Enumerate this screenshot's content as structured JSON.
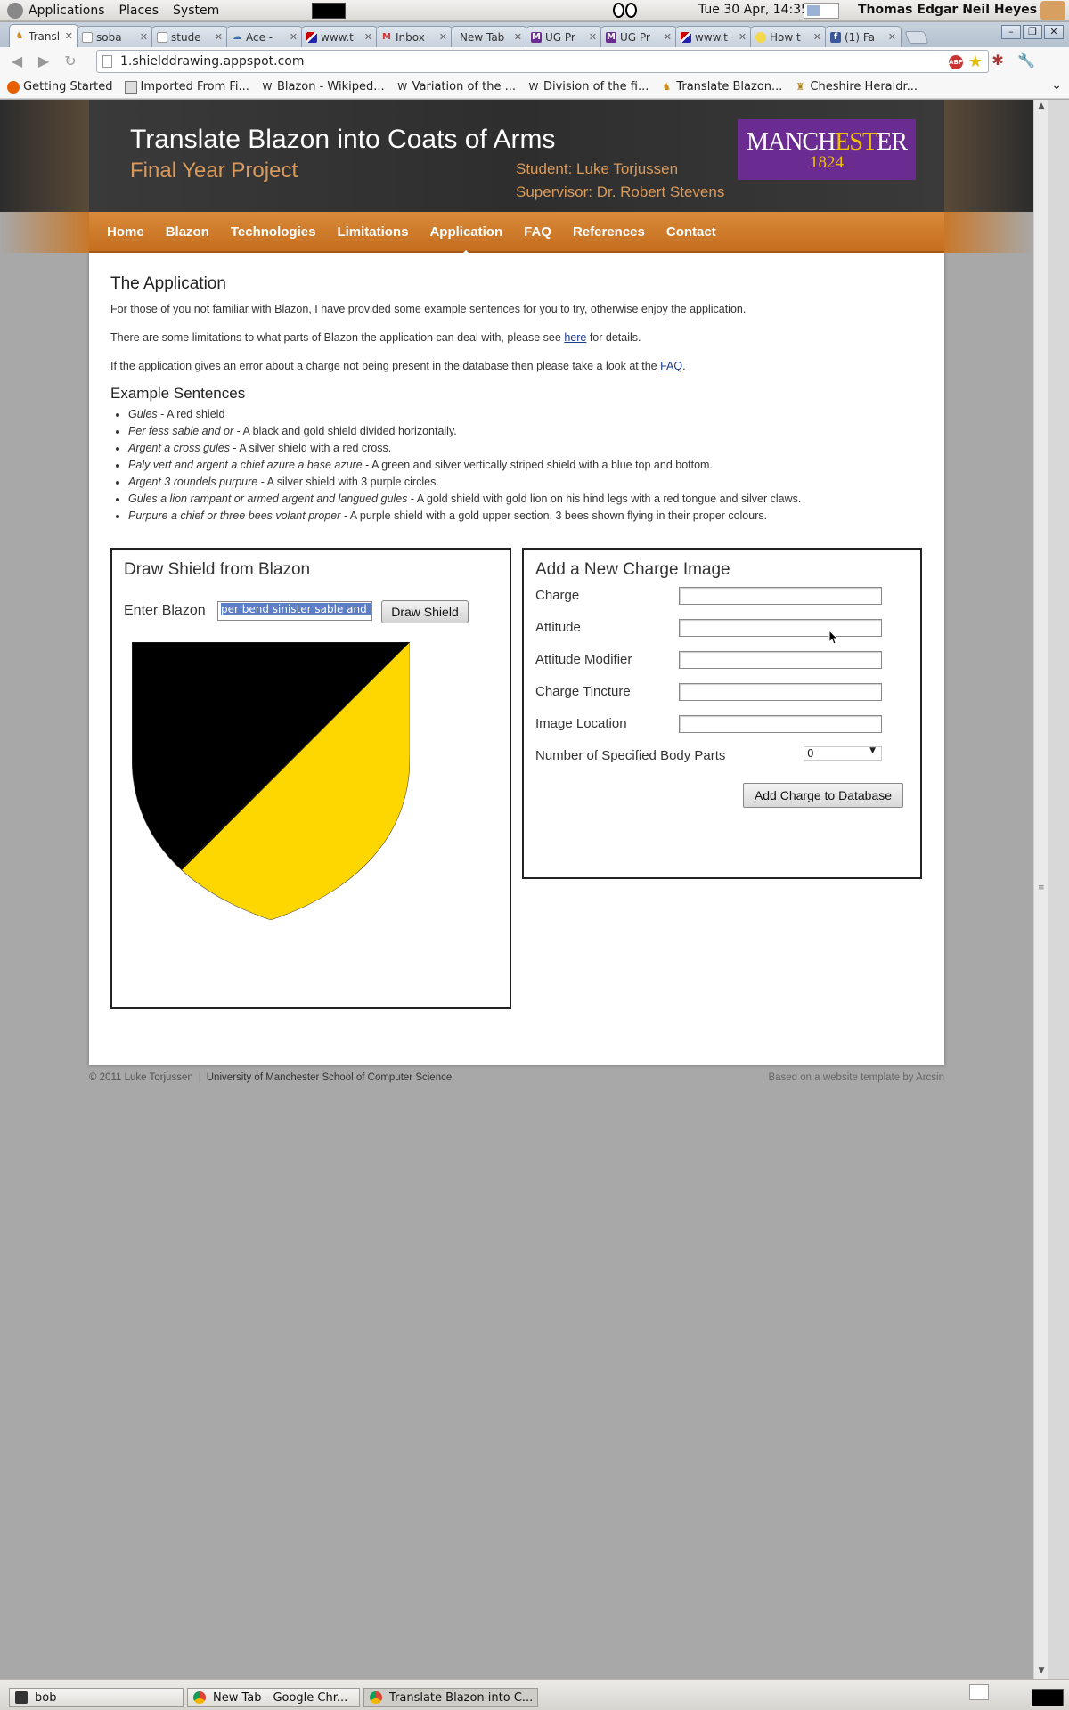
{
  "system_bar": {
    "menus": [
      "Applications",
      "Places",
      "System"
    ],
    "clock": "Tue 30 Apr, 14:35",
    "user": "Thomas Edgar Neil Heyes"
  },
  "tabs": [
    {
      "label": "Transl",
      "active": true
    },
    {
      "label": "soba"
    },
    {
      "label": "stude"
    },
    {
      "label": "Ace -"
    },
    {
      "label": "www.t"
    },
    {
      "label": "Inbox"
    },
    {
      "label": "New Tab"
    },
    {
      "label": "UG Pr"
    },
    {
      "label": "UG Pr"
    },
    {
      "label": "www.t"
    },
    {
      "label": "How t"
    },
    {
      "label": "(1) Fa"
    }
  ],
  "address_bar": {
    "url": "1.shielddrawing.appspot.com"
  },
  "bookmarks": [
    {
      "label": "Getting Started"
    },
    {
      "label": "Imported From Fi..."
    },
    {
      "label": "Blazon - Wikiped..."
    },
    {
      "label": "Variation of the ..."
    },
    {
      "label": "Division of the fi..."
    },
    {
      "label": "Translate Blazon..."
    },
    {
      "label": "Cheshire Heraldr..."
    }
  ],
  "header": {
    "title": "Translate Blazon into Coats of Arms",
    "subtitle": "Final Year Project",
    "student": "Student: Luke Torjussen",
    "supervisor": "Supervisor: Dr. Robert Stevens",
    "logo_main": "MANCHESTER",
    "logo_year": "1824"
  },
  "menu": [
    "Home",
    "Blazon",
    "Technologies",
    "Limitations",
    "Application",
    "FAQ",
    "References",
    "Contact"
  ],
  "menu_active": "Application",
  "content": {
    "heading": "The Application",
    "para1": "For those of you not familiar with Blazon, I have provided some example sentences for you to try, otherwise enjoy the application.",
    "para2_pre": "There are some limitations to what parts of Blazon the application can deal with, please see ",
    "para2_link": "here",
    "para2_post": " for details.",
    "para3_pre": "If the application gives an error about a charge not being present in the database then please take a look at the ",
    "para3_link": "FAQ",
    "para3_post": ".",
    "examples_heading": "Example Sentences",
    "examples": [
      {
        "blazon": "Gules",
        "desc": " - A red shield"
      },
      {
        "blazon": "Per fess sable and or",
        "desc": " - A black and gold shield divided horizontally."
      },
      {
        "blazon": "Argent a cross gules",
        "desc": " - A silver shield with a red cross."
      },
      {
        "blazon": "Paly vert and argent a chief azure a base azure",
        "desc": " - A green and silver vertically striped shield with a blue top and bottom."
      },
      {
        "blazon": "Argent 3 roundels purpure",
        "desc": " - A silver shield with 3 purple circles."
      },
      {
        "blazon": "Gules a lion rampant or armed argent and langued gules",
        "desc": " - A gold shield with gold lion on his hind legs with a red tongue and silver claws."
      },
      {
        "blazon": "Purpure a chief or three bees volant proper",
        "desc": " - A purple shield with a gold upper section, 3 bees shown flying in their proper colours."
      }
    ]
  },
  "draw_panel": {
    "title": "Draw Shield from Blazon",
    "input_label": "Enter Blazon",
    "input_value": "per bend sinister sable and o",
    "button": "Draw Shield",
    "shield_colors": {
      "left": "#000000",
      "right": "#ffd700"
    }
  },
  "charge_panel": {
    "title": "Add a New Charge Image",
    "fields": [
      {
        "label": "Charge",
        "value": ""
      },
      {
        "label": "Attitude",
        "value": ""
      },
      {
        "label": "Attitude Modifier",
        "value": ""
      },
      {
        "label": "Charge Tincture",
        "value": ""
      },
      {
        "label": "Image Location",
        "value": ""
      }
    ],
    "parts_label": "Number of Specified Body Parts",
    "parts_value": "0",
    "button": "Add Charge to Database"
  },
  "footer": {
    "copyright": "© 2011 Luke Torjussen",
    "university": "University of Manchester School of Computer Science",
    "credit": "Based on a website template by Arcsin"
  },
  "taskbar": [
    {
      "label": "bob"
    },
    {
      "label": "New Tab - Google Chr..."
    },
    {
      "label": "Translate Blazon into C..."
    }
  ],
  "colors": {
    "accent_orange": "#c8782a",
    "header_dark": "#333333",
    "link": "#1a3b8e",
    "univ_purple": "#6b2c91"
  }
}
